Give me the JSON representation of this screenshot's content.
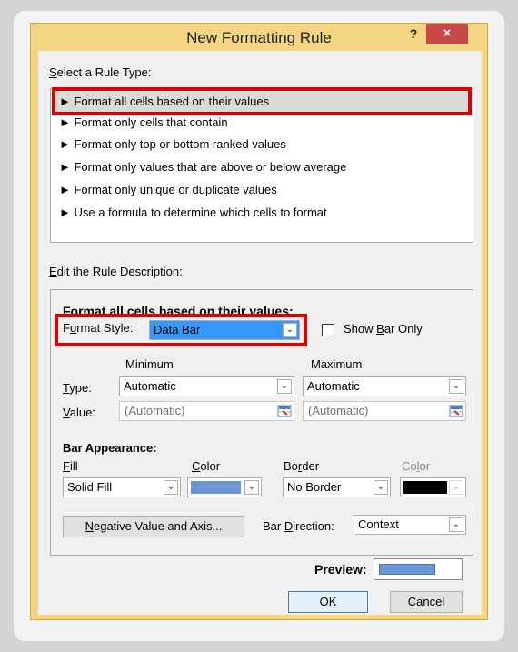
{
  "dialog": {
    "title": "New Formatting Rule",
    "help_label": "?",
    "close_label": "×"
  },
  "rule_type": {
    "label": "Select a Rule Type:",
    "items": [
      "► Format all cells based on their values",
      "► Format only cells that contain",
      "► Format only top or bottom ranked values",
      "► Format only values that are above or below average",
      "► Format only unique or duplicate values",
      "► Use a formula to determine which cells to format"
    ],
    "selected_index": 0
  },
  "description": {
    "label": "Edit the Rule Description:",
    "heading": "Format all cells based on their values:",
    "format_style_label": "Format Style:",
    "format_style_value": "Data Bar",
    "show_bar_only_label": "Show Bar Only",
    "show_bar_only_checked": false,
    "minimum_header": "Minimum",
    "maximum_header": "Maximum",
    "type_label": "Type:",
    "value_label": "Value:",
    "min_type": "Automatic",
    "max_type": "Automatic",
    "min_value": "(Automatic)",
    "max_value": "(Automatic)"
  },
  "bar_appearance": {
    "heading": "Bar Appearance:",
    "fill_label": "Fill",
    "color_label": "Color",
    "border_label": "Border",
    "border_color_label": "Color",
    "fill_value": "Solid Fill",
    "fill_color": "#6b96d3",
    "border_value": "No Border",
    "border_color": "#000000",
    "negative_button": "Negative Value and Axis...",
    "bar_direction_label": "Bar Direction:",
    "bar_direction_value": "Context",
    "preview_label": "Preview:"
  },
  "buttons": {
    "ok": "OK",
    "cancel": "Cancel"
  },
  "colors": {
    "title_bar": "#f5d682",
    "close": "#c74949",
    "highlight": "#e00000",
    "selection": "#3399ff"
  }
}
